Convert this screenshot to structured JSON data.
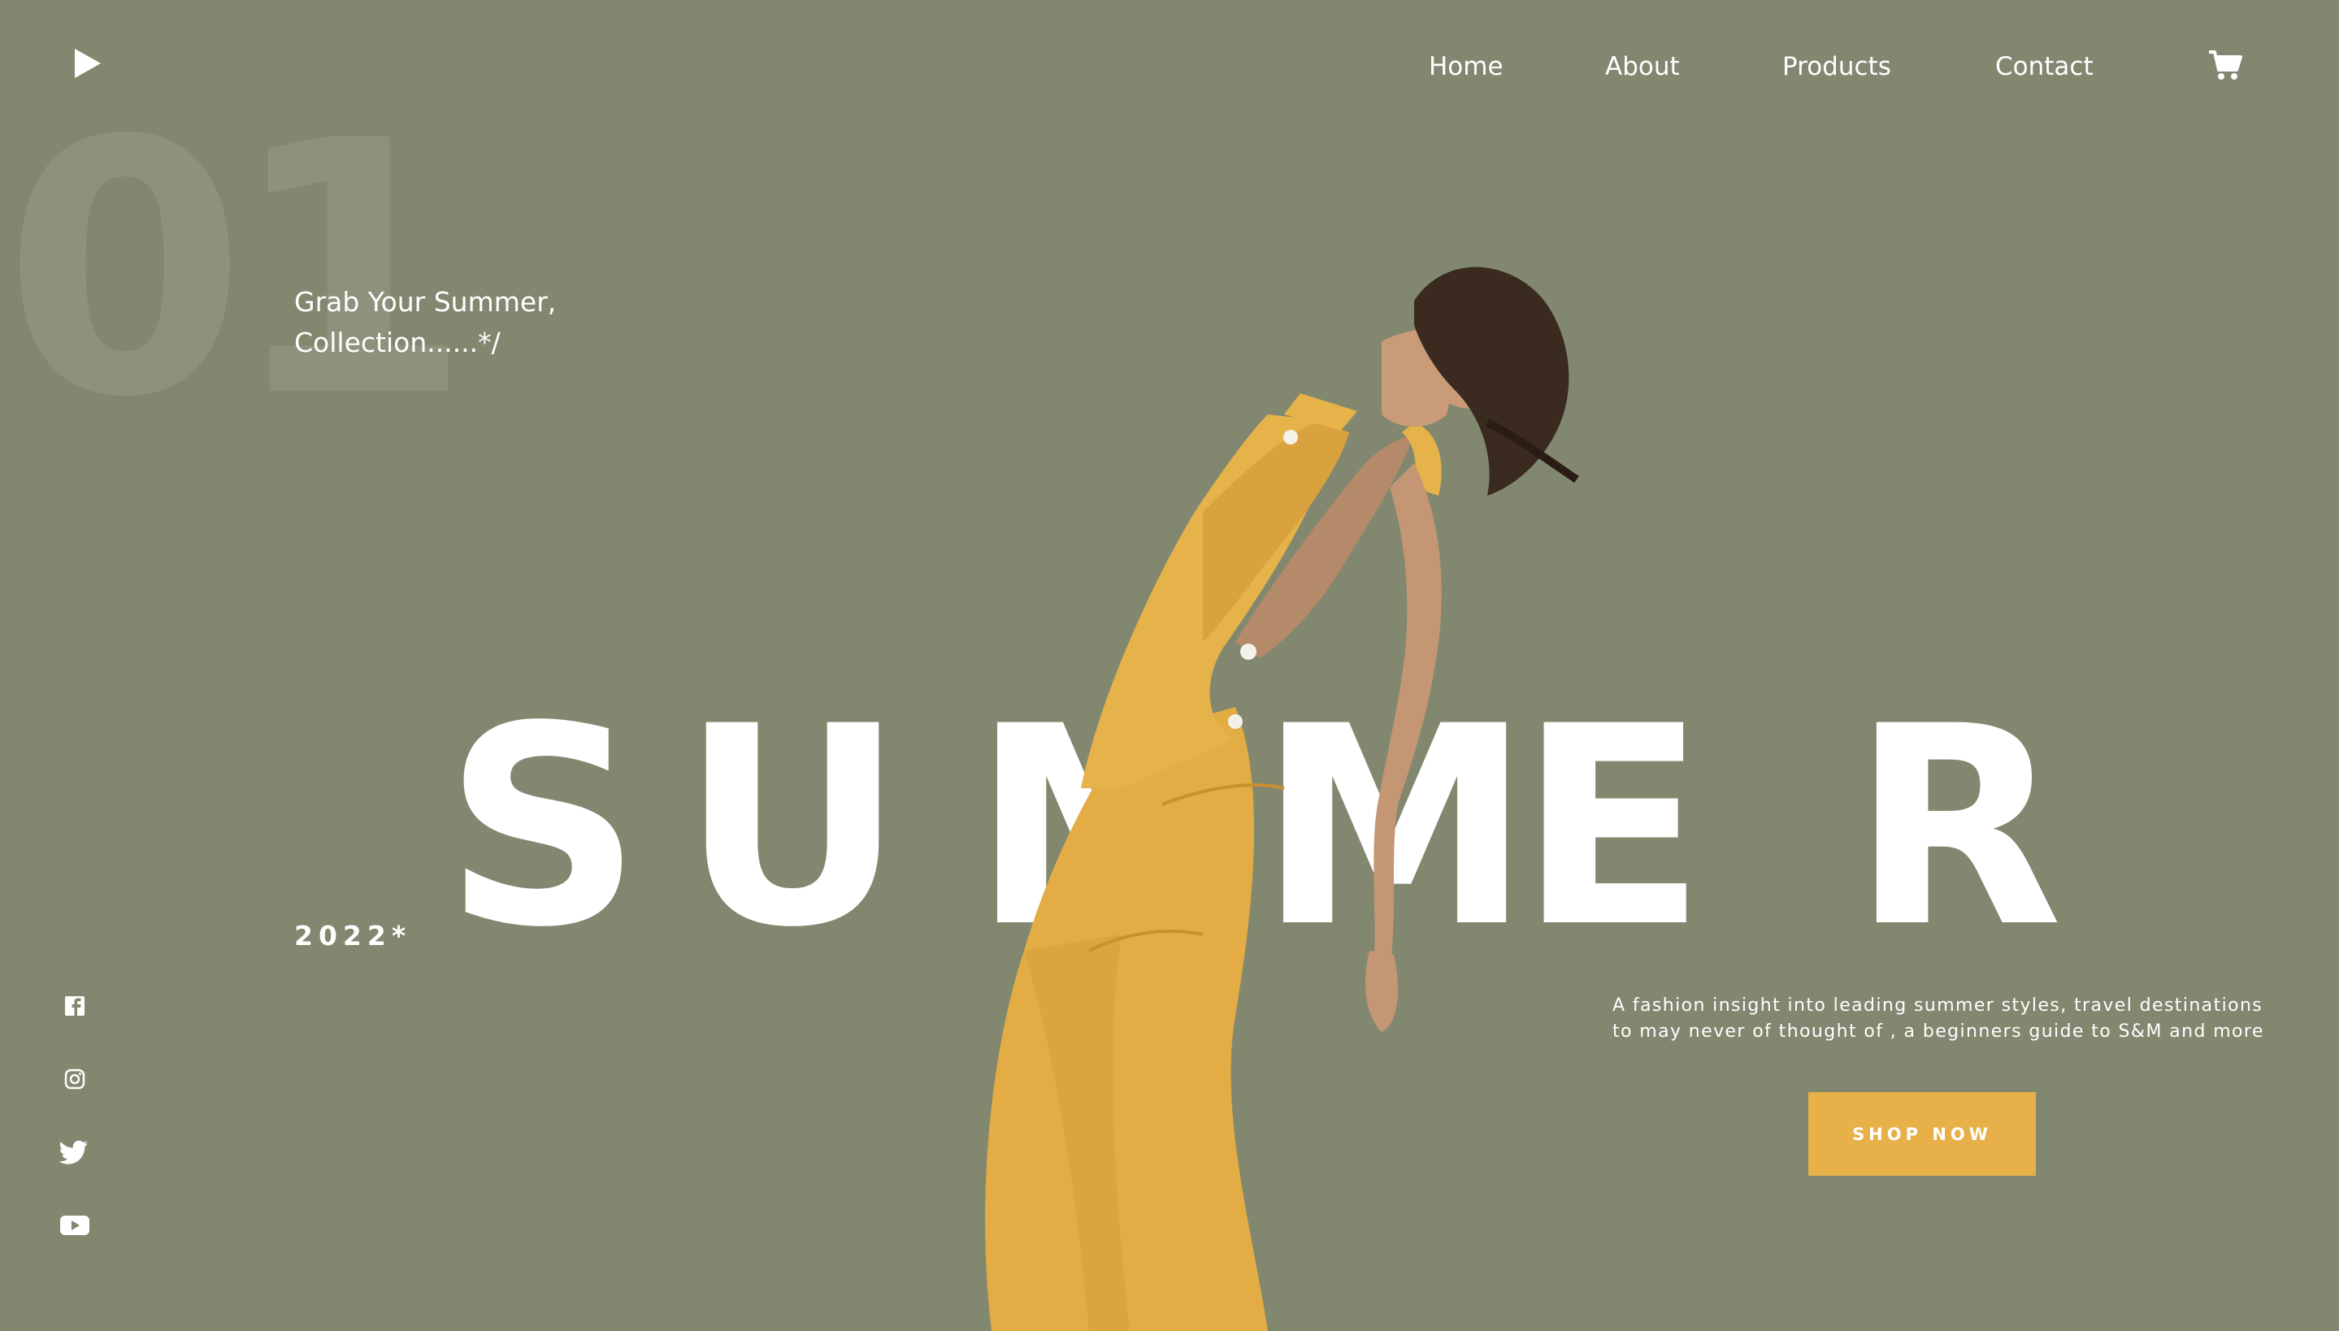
{
  "header": {
    "logo_icon": "play-icon",
    "nav": [
      {
        "label": "Home"
      },
      {
        "label": "About"
      },
      {
        "label": "Products"
      },
      {
        "label": "Contact"
      }
    ],
    "cart_icon": "shopping-cart-icon"
  },
  "hero": {
    "slide_number": "01",
    "tagline_line1": "Grab Your Summer,",
    "tagline_line2": "Collection......*/",
    "headline_letters": [
      "S",
      "U",
      "M",
      "M",
      "E",
      "R"
    ],
    "year": "2022*",
    "description_line1": "A fashion insight into leading summer styles, travel destinations",
    "description_line2": "to may never of thought of , a beginners guide to S&M and more",
    "cta_label": "SHOP NOW"
  },
  "social": [
    {
      "icon": "facebook-icon"
    },
    {
      "icon": "instagram-icon"
    },
    {
      "icon": "twitter-icon"
    },
    {
      "icon": "youtube-icon"
    }
  ],
  "colors": {
    "background": "#82886f",
    "accent": "#e8b048",
    "text": "#ffffff",
    "garment": "#e6b24a"
  }
}
